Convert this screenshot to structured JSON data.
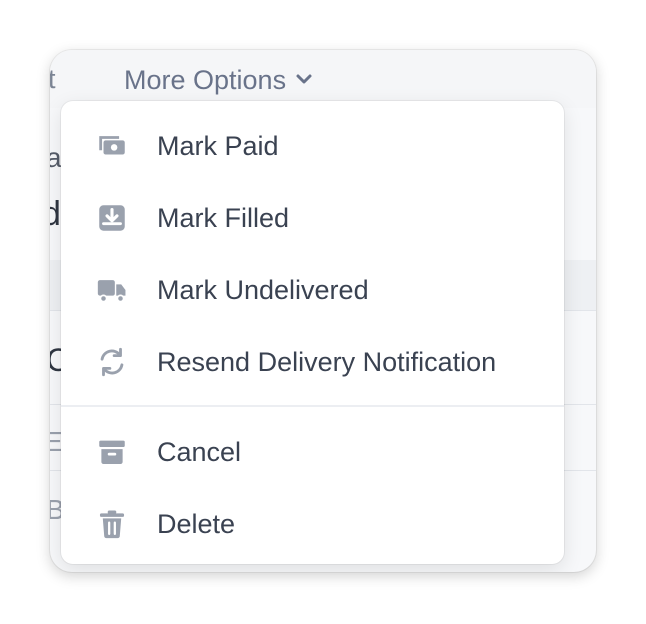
{
  "toolbar": {
    "left_fragment": "t",
    "more_options_label": "More Options"
  },
  "background": {
    "frag_a": "a",
    "frag_d": "d",
    "frag_c": "C",
    "frag_e": "E",
    "frag_b": "B"
  },
  "menu": {
    "items": [
      {
        "label": "Mark Paid",
        "icon": "cash-icon"
      },
      {
        "label": "Mark Filled",
        "icon": "download-tray-icon"
      },
      {
        "label": "Mark Undelivered",
        "icon": "truck-icon"
      },
      {
        "label": "Resend Delivery Notification",
        "icon": "refresh-icon"
      },
      {
        "label": "Cancel",
        "icon": "archive-icon"
      },
      {
        "label": "Delete",
        "icon": "trash-icon"
      }
    ]
  },
  "colors": {
    "icon": "#9aa1ad",
    "text": "#3a4251",
    "muted": "#69738a"
  }
}
